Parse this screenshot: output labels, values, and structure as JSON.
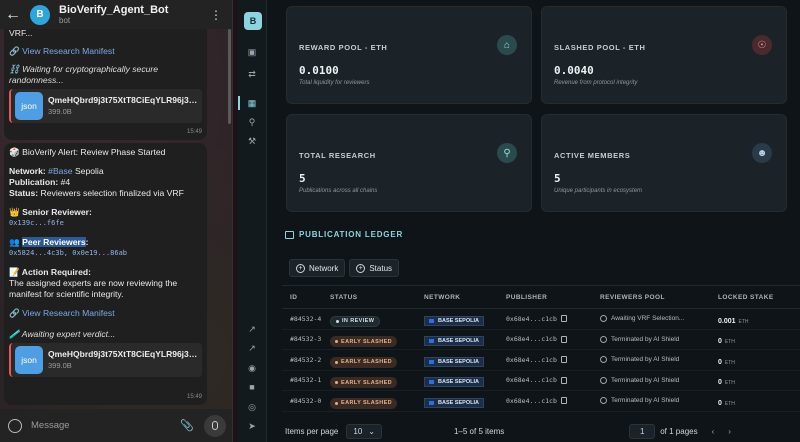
{
  "telegram": {
    "bot_name": "BioVerify_Agent_Bot",
    "bot_sub": "bot",
    "avatar_letter": "B",
    "msg1": {
      "top_text": "VRF...",
      "link": "🔗 View Research Manifest",
      "waiting": "⛓️ Waiting for cryptographically secure randomness...",
      "file_name": "QmeHQbrd9j3t75XtT8CiEqYLR96j3md...",
      "file_size": "399.0B",
      "file_ext": "json",
      "time": "15:49"
    },
    "msg2": {
      "alert": "🎲 BioVerify Alert: Review Phase Started",
      "network_label": "Network:",
      "network_tag": "#Base",
      "network_rest": "Sepolia",
      "publication_label": "Publication:",
      "publication_value": "#4",
      "status_label": "Status:",
      "status_value": "Reviewers selection finalized via VRF",
      "senior_label": "👑 Senior Reviewer:",
      "senior_addr": "0x139c...f6fe",
      "peer_prefix": "👥 ",
      "peer_label": "Peer Reviewers",
      "peer_colon": ":",
      "peer_addr1": "0x5824...4c3b",
      "peer_addr2": "0x0e19...86ab",
      "action_label": "📝 Action Required:",
      "action_text": "The assigned experts are now reviewing the manifest for scientific integrity.",
      "link": "🔗 View Research Manifest",
      "awaiting": "🧪 Awaiting expert verdict...",
      "file_name": "QmeHQbrd9j3t75XtT8CiEqYLR96j3md...",
      "file_size": "399.0B",
      "file_ext": "json",
      "time": "15:49"
    },
    "input_placeholder": "Message"
  },
  "app": {
    "logo_letter": "B",
    "cards": [
      {
        "label": "REWARD POOL - ETH",
        "value": "0.0100",
        "sub": "Total liquidity for reviewers",
        "icon": "bank-icon"
      },
      {
        "label": "SLASHED POOL - ETH",
        "value": "0.0040",
        "sub": "Revenue from protocol integrity",
        "icon": "shield-icon"
      },
      {
        "label": "TOTAL RESEARCH",
        "value": "5",
        "sub": "Publications across all chains",
        "icon": "flask-icon"
      },
      {
        "label": "ACTIVE MEMBERS",
        "value": "5",
        "sub": "Unique participants in ecosystem",
        "icon": "users-icon"
      }
    ],
    "ledger_title": "PUBLICATION LEDGER",
    "filters": [
      "Network",
      "Status"
    ],
    "columns": [
      "ID",
      "STATUS",
      "NETWORK",
      "PUBLISHER",
      "REVIEWERS POOL",
      "LOCKED STAKE"
    ],
    "rows": [
      {
        "id": "#84532-4",
        "status": "IN REVIEW",
        "status_kind": "review",
        "network": "BASE SEPOLIA",
        "publisher": "0x68e4...c1cb",
        "reviewers": "Awaiting VRF Selection...",
        "stake": "0.001",
        "unit": "ETH"
      },
      {
        "id": "#84532-3",
        "status": "EARLY SLASHED",
        "status_kind": "slashed",
        "network": "BASE SEPOLIA",
        "publisher": "0x68e4...c1cb",
        "reviewers": "Terminated by AI Shield",
        "stake": "0",
        "unit": "ETH"
      },
      {
        "id": "#84532-2",
        "status": "EARLY SLASHED",
        "status_kind": "slashed",
        "network": "BASE SEPOLIA",
        "publisher": "0x68e4...c1cb",
        "reviewers": "Terminated by AI Shield",
        "stake": "0",
        "unit": "ETH"
      },
      {
        "id": "#84532-1",
        "status": "EARLY SLASHED",
        "status_kind": "slashed",
        "network": "BASE SEPOLIA",
        "publisher": "0x68e4...c1cb",
        "reviewers": "Terminated by AI Shield",
        "stake": "0",
        "unit": "ETH"
      },
      {
        "id": "#84532-0",
        "status": "EARLY SLASHED",
        "status_kind": "slashed",
        "network": "BASE SEPOLIA",
        "publisher": "0x68e4...c1cb",
        "reviewers": "Terminated by AI Shield",
        "stake": "0",
        "unit": "ETH"
      }
    ],
    "footer": {
      "per_page_label": "Items per page",
      "per_page_value": "10",
      "range": "1–5 of 5 items",
      "page_value": "1",
      "of_pages": "of 1 pages"
    }
  }
}
